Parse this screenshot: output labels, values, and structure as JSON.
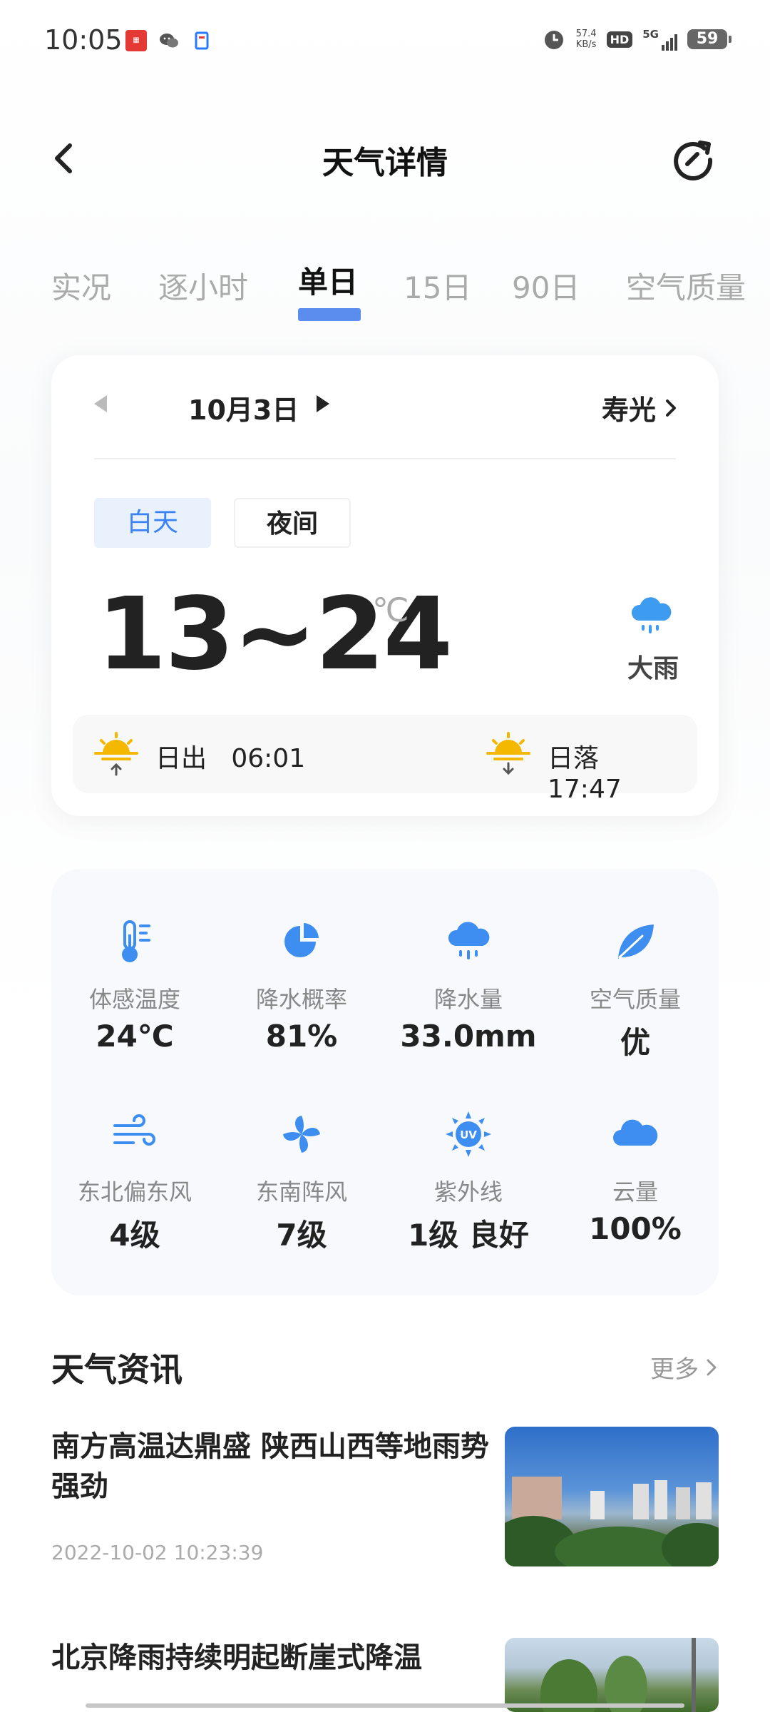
{
  "status_bar": {
    "time": "10:05",
    "net_speed_value": "57.4",
    "net_speed_unit": "KB/s",
    "hd": "HD",
    "network": "5G",
    "battery": "59"
  },
  "header": {
    "title": "天气详情"
  },
  "tabs": [
    {
      "label": "实况"
    },
    {
      "label": "逐小时"
    },
    {
      "label": "单日"
    },
    {
      "label": "15日"
    },
    {
      "label": "90日"
    },
    {
      "label": "空气质量"
    }
  ],
  "day_card": {
    "date": "10月3日",
    "city": "寿光",
    "day_label": "白天",
    "night_label": "夜间",
    "temp_range": "13~24",
    "temp_unit": "℃",
    "weather": "大雨",
    "sunrise_label": "日出",
    "sunrise_time": "06:01",
    "sunset_label": "日落",
    "sunset_time": "17:47"
  },
  "details": [
    {
      "label": "体感温度",
      "value": "24℃",
      "icon": "thermometer-icon"
    },
    {
      "label": "降水概率",
      "value": "81%",
      "icon": "pie-chart-icon"
    },
    {
      "label": "降水量",
      "value": "33.0mm",
      "icon": "rain-cloud-icon"
    },
    {
      "label": "空气质量",
      "value": "优",
      "icon": "leaf-icon"
    },
    {
      "label": "东北偏东风",
      "value": "4级",
      "icon": "wind-icon"
    },
    {
      "label": "东南阵风",
      "value": "7级",
      "icon": "pinwheel-icon"
    },
    {
      "label": "紫外线",
      "value": "1级 良好",
      "icon": "uv-icon"
    },
    {
      "label": "云量",
      "value": "100%",
      "icon": "cloud-icon"
    }
  ],
  "news": {
    "title": "天气资讯",
    "more": "更多",
    "items": [
      {
        "headline": "南方高温达鼎盛 陕西山西等地雨势强劲",
        "date": "2022-10-02 10:23:39"
      },
      {
        "headline": "北京降雨持续明起断崖式降温",
        "date": ""
      }
    ]
  },
  "colors": {
    "accent": "#3b82f6",
    "tab_indicator": "#5b8def",
    "icon_blue": "#3d8ef0",
    "sun_yellow": "#f5b800"
  }
}
